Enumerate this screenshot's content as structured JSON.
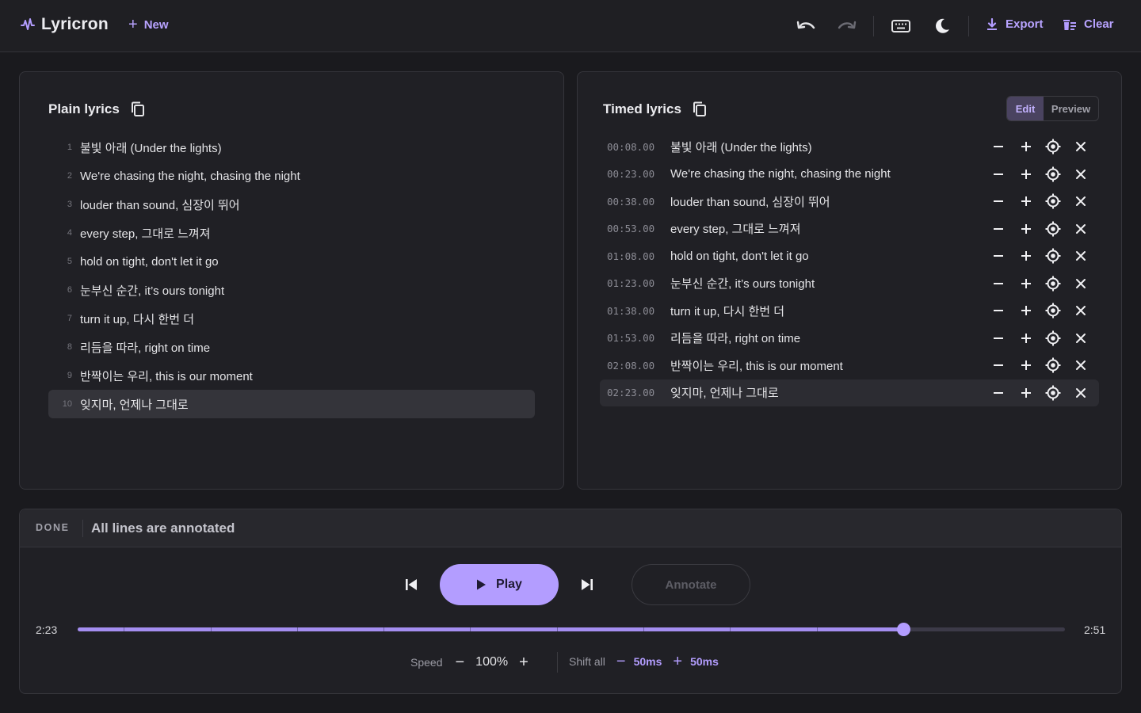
{
  "header": {
    "app_name": "Lyricron",
    "new_label": "New",
    "export_label": "Export",
    "clear_label": "Clear",
    "icons": [
      "logo-waveform-icon",
      "plus-icon",
      "undo-icon",
      "redo-icon",
      "keyboard-icon",
      "moon-icon",
      "download-icon",
      "trash-icon"
    ]
  },
  "plain": {
    "title": "Plain lyrics",
    "lines": [
      {
        "num": "1",
        "text": "불빛 아래 (Under the lights)"
      },
      {
        "num": "2",
        "text": "We're chasing the night, chasing the night"
      },
      {
        "num": "3",
        "text": "louder than sound, 심장이 뛰어"
      },
      {
        "num": "4",
        "text": "every step, 그대로 느껴져"
      },
      {
        "num": "5",
        "text": "hold on tight, don't let it go"
      },
      {
        "num": "6",
        "text": "눈부신 순간, it’s ours tonight"
      },
      {
        "num": "7",
        "text": "turn it up, 다시 한번 더"
      },
      {
        "num": "8",
        "text": "리듬을 따라, right on time"
      },
      {
        "num": "9",
        "text": "반짝이는 우리, this is our moment"
      },
      {
        "num": "10",
        "text": "잊지마, 언제나 그대로"
      }
    ]
  },
  "timed": {
    "title": "Timed lyrics",
    "mode_edit": "Edit",
    "mode_preview": "Preview",
    "lines": [
      {
        "time": "00:08.00",
        "text": "불빛 아래 (Under the lights)"
      },
      {
        "time": "00:23.00",
        "text": "We're chasing the night, chasing the night"
      },
      {
        "time": "00:38.00",
        "text": "louder than sound, 심장이 뛰어"
      },
      {
        "time": "00:53.00",
        "text": "every step, 그대로 느껴져"
      },
      {
        "time": "01:08.00",
        "text": "hold on tight, don't let it go"
      },
      {
        "time": "01:23.00",
        "text": "눈부신 순간, it’s ours tonight"
      },
      {
        "time": "01:38.00",
        "text": "turn it up, 다시 한번 더"
      },
      {
        "time": "01:53.00",
        "text": "리듬을 따라, right on time"
      },
      {
        "time": "02:08.00",
        "text": "반짝이는 우리, this is our moment"
      },
      {
        "time": "02:23.00",
        "text": "잊지마, 언제나 그대로"
      }
    ]
  },
  "status": {
    "tag": "DONE",
    "message": "All lines are annotated"
  },
  "player": {
    "play_label": "Play",
    "annotate_label": "Annotate",
    "current_time": "2:23",
    "total_time": "2:51",
    "progress_fraction": 0.836,
    "marker_times_sec": [
      8,
      23,
      38,
      53,
      68,
      83,
      98,
      113,
      128,
      143
    ],
    "duration_sec": 171,
    "speed_label": "Speed",
    "speed_value": "100%",
    "shift_label": "Shift all",
    "shift_minus": "50ms",
    "shift_plus": "50ms"
  },
  "colors": {
    "accent": "#b39dff",
    "background": "#1a1a1e",
    "panel": "#202025"
  }
}
